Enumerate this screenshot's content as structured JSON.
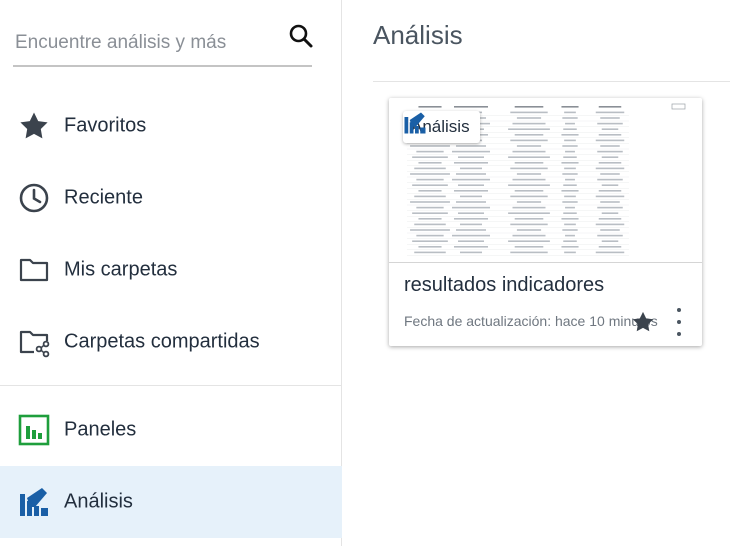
{
  "search": {
    "placeholder": "Encuentre análisis y más",
    "icon": "search-icon"
  },
  "sidebar": {
    "items": [
      {
        "label": "Favoritos",
        "icon": "star-icon"
      },
      {
        "label": "Reciente",
        "icon": "clock-icon"
      },
      {
        "label": "Mis carpetas",
        "icon": "folder-icon"
      },
      {
        "label": "Carpetas compartidas",
        "icon": "shared-folder-icon"
      },
      {
        "label": "Paneles",
        "icon": "dashboard-icon"
      },
      {
        "label": "Análisis",
        "icon": "analysis-icon",
        "active": true
      }
    ]
  },
  "main": {
    "title": "Análisis",
    "cards": [
      {
        "badge": "Análisis",
        "name": "resultados indicadores",
        "updated": "Fecha de actualización: hace 10 minutos"
      }
    ]
  },
  "colors": {
    "accent": "#1a73c4",
    "active_bg": "#e6f1fa",
    "dashboard_green": "#1e9e3c",
    "text": "#232f3e"
  }
}
